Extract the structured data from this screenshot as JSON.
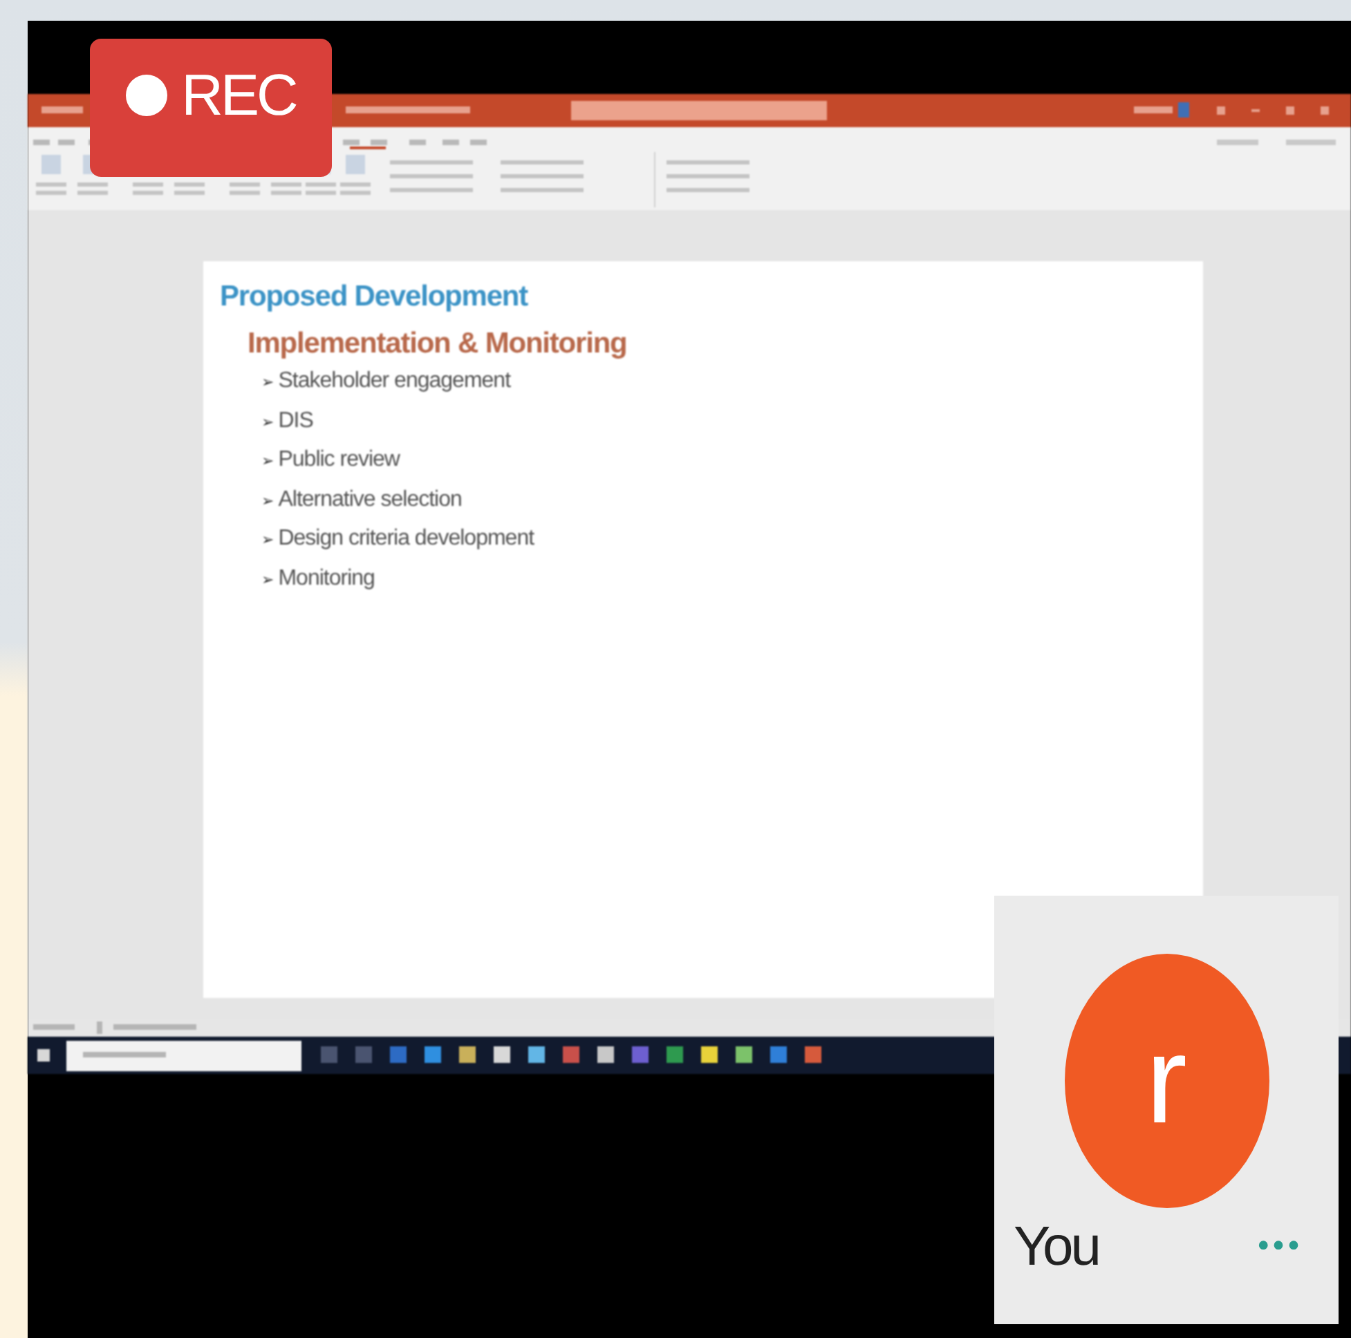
{
  "recording": {
    "label": "REC",
    "on": true
  },
  "slide": {
    "title": "Proposed Development",
    "subtitle": "Implementation & Monitoring",
    "marker": "➢",
    "bullets": [
      "Stakeholder engagement",
      "DIS",
      "Public review",
      "Alternative selection",
      "Design criteria development",
      "Monitoring"
    ]
  },
  "participant": {
    "initial": "r",
    "name": "You",
    "more": "•••"
  }
}
